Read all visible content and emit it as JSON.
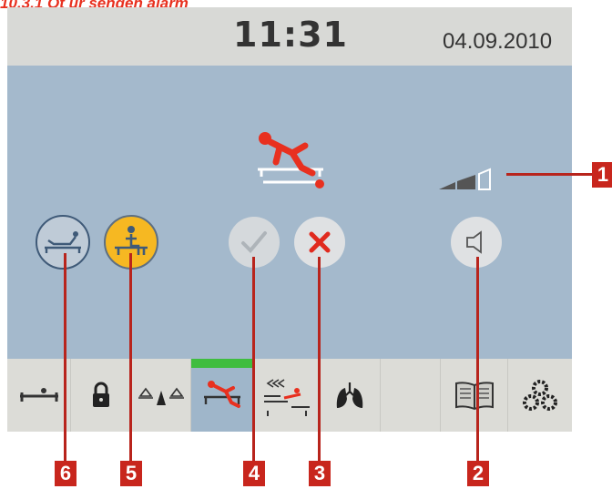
{
  "heading": "10.3.1 Ot ur sengen alarm",
  "status_bar": {
    "time": "11:31",
    "date": "04.09.2010"
  },
  "alarm": {
    "icon": "bed-exit-alarm-icon",
    "volume_icon": "volume-level-icon"
  },
  "buttons": {
    "monitor_bed": "bed-occupancy-monitor-icon",
    "monitor_sit": "sitting-exit-monitor-icon",
    "confirm": "checkmark-icon",
    "cancel": "cross-icon",
    "speaker": "speaker-icon"
  },
  "tabs": [
    "bed-position-icon",
    "lock-icon",
    "scale-icon",
    "bed-exit-icon",
    "trend-icon",
    "lungs-icon",
    "empty",
    "manual-icon",
    "settings-icon"
  ],
  "callouts": [
    "1",
    "2",
    "3",
    "4",
    "5",
    "6"
  ],
  "colors": {
    "accent_red": "#e8301f",
    "screen_bg": "#a4b9cc",
    "active_tab": "#3fbd3f",
    "sit_button": "#f6b822"
  }
}
